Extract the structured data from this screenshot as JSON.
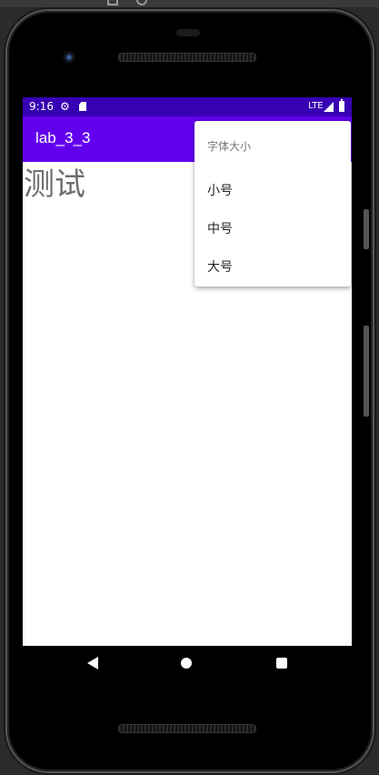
{
  "status_bar": {
    "time": "9:16",
    "network": "LTE",
    "icons": [
      "settings-icon",
      "sd-card-icon",
      "signal-icon",
      "battery-icon"
    ]
  },
  "app_bar": {
    "title": "lab_3_3"
  },
  "content": {
    "text": "测试"
  },
  "popup_menu": {
    "header": "字体大小",
    "items": [
      {
        "label": "小号"
      },
      {
        "label": "中号"
      },
      {
        "label": "大号"
      }
    ]
  },
  "nav_bar": {
    "icons": [
      "back-icon",
      "home-icon",
      "recents-icon"
    ]
  },
  "colors": {
    "status_bar": "#3700b3",
    "app_bar": "#6200ee",
    "content_text": "#6e6e6e"
  }
}
